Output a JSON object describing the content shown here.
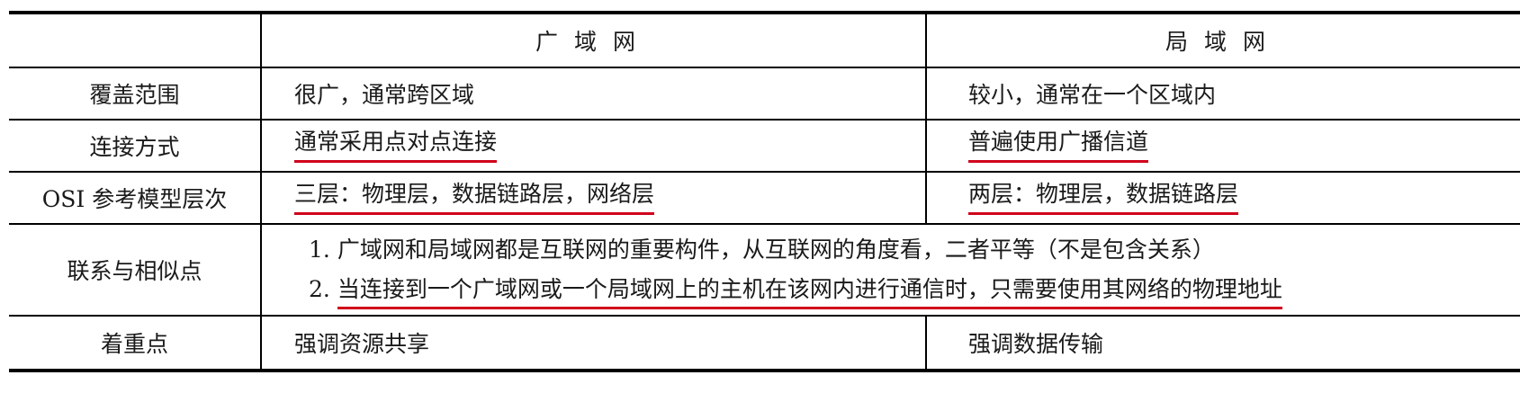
{
  "table": {
    "header": {
      "blank": "",
      "wan": "广域网",
      "lan": "局域网"
    },
    "rows": [
      {
        "label": "覆盖范围",
        "wan": "很广，通常跨区域",
        "lan": "较小，通常在一个区域内"
      },
      {
        "label": "连接方式",
        "wan": "通常采用点对点连接",
        "lan": "普遍使用广播信道"
      },
      {
        "label": "OSI 参考模型层次",
        "wan": "三层：物理层，数据链路层，网络层",
        "lan": "两层：物理层，数据链路层"
      },
      {
        "label": "联系与相似点",
        "line1_num": "1.",
        "line1": "广域网和局域网都是互联网的重要构件，从互联网的角度看，二者平等（不是包含关系）",
        "line2_num": "2.",
        "line2": "当连接到一个广域网或一个局域网上的主机在该网内进行通信时，只需要使用其网络的物理地址"
      },
      {
        "label": "着重点",
        "wan": "强调资源共享",
        "lan": "强调数据传输"
      }
    ]
  },
  "colors": {
    "underline": "#d0021b",
    "rule": "#000000"
  }
}
